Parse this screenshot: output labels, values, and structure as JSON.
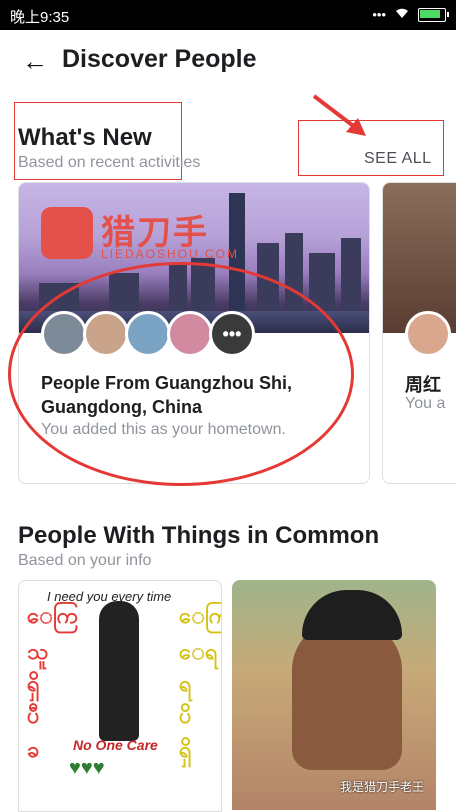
{
  "status_bar": {
    "time": "晚上9:35",
    "signal": "...",
    "wifi": "wifi",
    "battery": "battery"
  },
  "appbar": {
    "back_icon": "←",
    "title": "Discover People"
  },
  "whats_new": {
    "title": "What's New",
    "subtitle": "Based on recent activities",
    "see_all": "SEE ALL",
    "cards": [
      {
        "logo_text": "猎刀手",
        "logo_sub": "LIEDAOSHOU.COM",
        "more_icon": "•••",
        "title": "People From Guangzhou Shi, Guangdong, China",
        "subtitle": "You added this as your hometown."
      },
      {
        "title": "周红",
        "subtitle": "You a"
      }
    ]
  },
  "common": {
    "title": "People With Things in Common",
    "subtitle": "Based on your info",
    "card1_caption": "I need you every time",
    "card1_badge": "No One Care"
  },
  "watermark": "我是猎刀手老王",
  "colors": {
    "accent_red": "#e53935",
    "text_dark": "#1c1e21",
    "text_gray": "#90949c"
  }
}
